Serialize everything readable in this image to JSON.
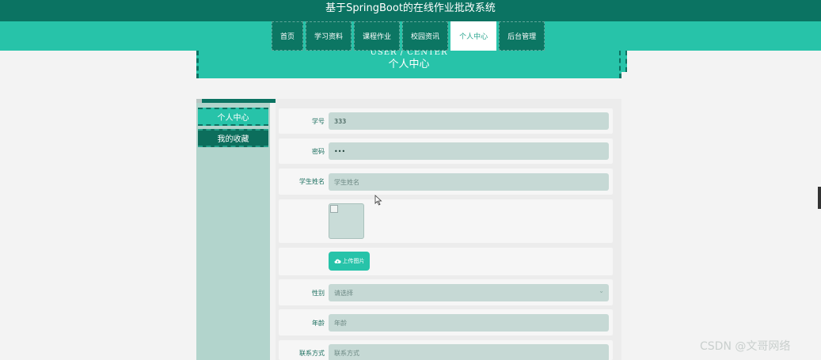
{
  "app": {
    "title": "基于SpringBoot的在线作业批改系统"
  },
  "nav": {
    "items": [
      {
        "label": "首页"
      },
      {
        "label": "学习资料"
      },
      {
        "label": "课程作业"
      },
      {
        "label": "校园资讯"
      },
      {
        "label": "个人中心",
        "active": true
      },
      {
        "label": "后台管理"
      }
    ]
  },
  "hero": {
    "en": "USER / CENTER",
    "cn": "个人中心"
  },
  "sidebar": {
    "items": [
      {
        "label": "个人中心",
        "active": true
      },
      {
        "label": "我的收藏"
      }
    ]
  },
  "form": {
    "student_id": {
      "label": "学号",
      "value": "333"
    },
    "password": {
      "label": "密码",
      "value": "•••"
    },
    "student_name": {
      "label": "学生姓名",
      "placeholder": "学生姓名"
    },
    "upload": {
      "label": "上传图片"
    },
    "gender": {
      "label": "性别",
      "placeholder": "请选择"
    },
    "age": {
      "label": "年龄",
      "placeholder": "年龄"
    },
    "contact": {
      "label": "联系方式",
      "placeholder": "联系方式"
    }
  },
  "watermark": "CSDN @文哥网络",
  "colors": {
    "dark_teal": "#0b7362",
    "teal": "#27c3a9",
    "field": "#c6d9d5",
    "sidebar": "#b2d4cc"
  }
}
